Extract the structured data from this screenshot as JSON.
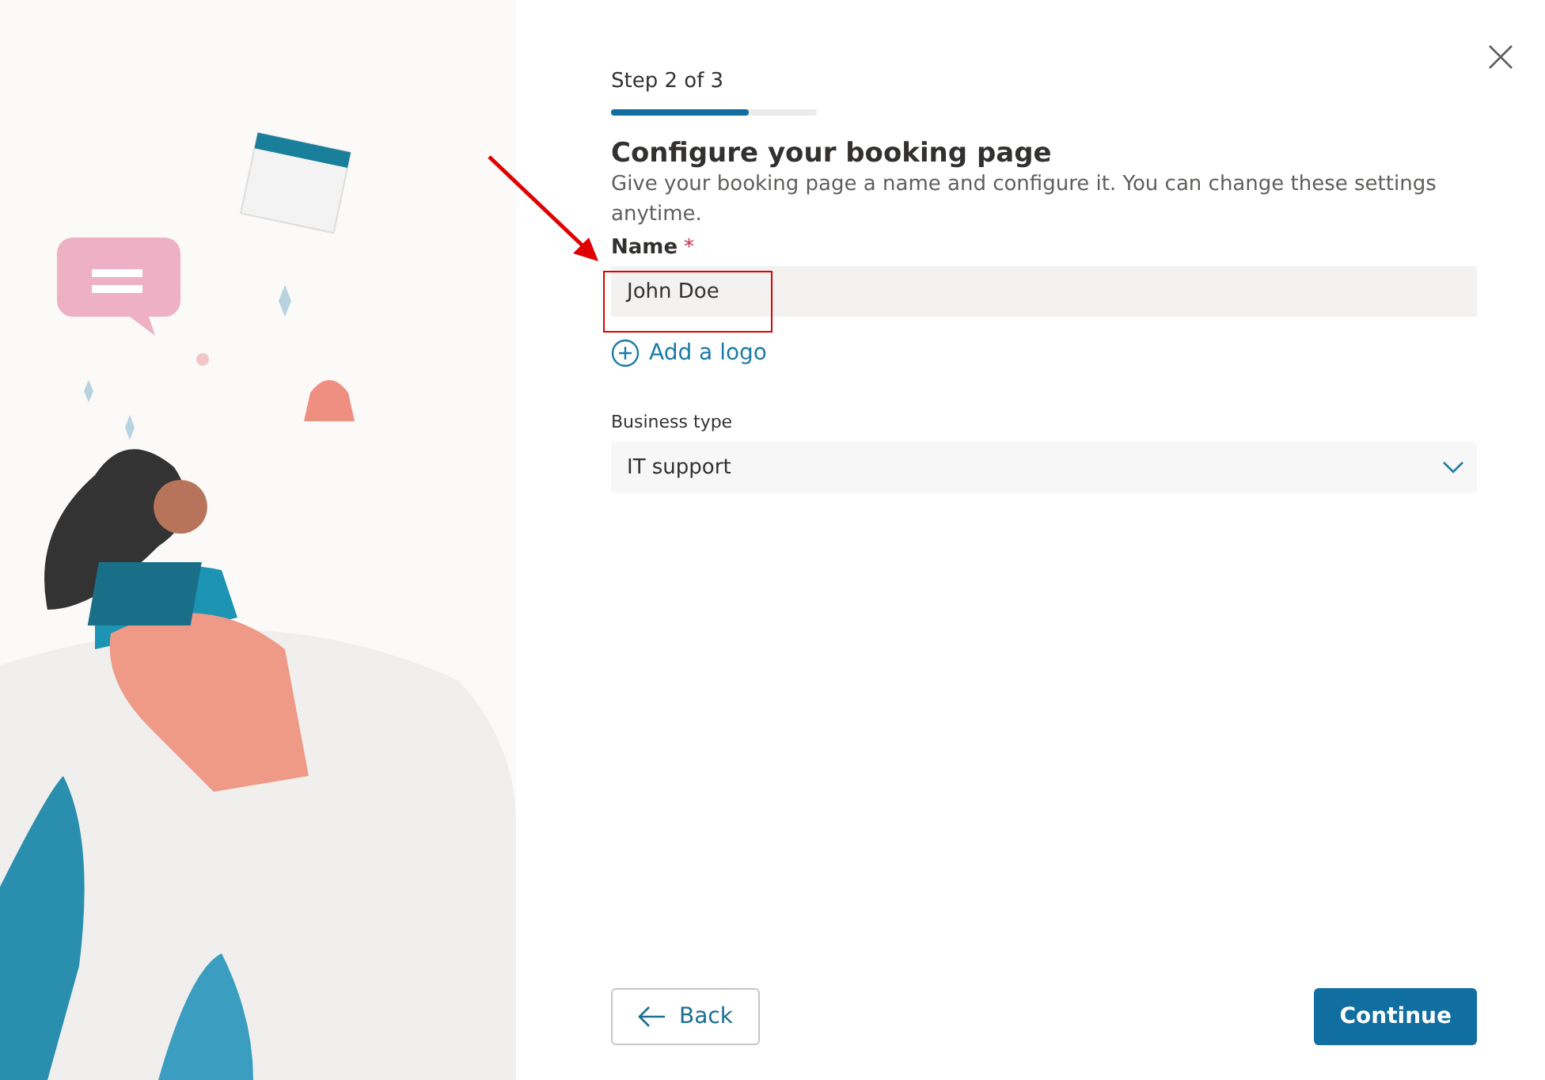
{
  "step": {
    "label": "Step 2 of 3",
    "level": 0.67
  },
  "heading": "Configure your booking page",
  "description": "Give your booking page a name and configure it. You can change these settings anytime.",
  "name_field": {
    "label": "Name",
    "required_mark": "*",
    "value": "John Doe"
  },
  "add_logo": {
    "label": "Add a logo"
  },
  "business_type": {
    "label": "Business type",
    "value": "IT support"
  },
  "buttons": [
    {
      "kind": "secondary",
      "label": "Back"
    },
    {
      "kind": "primary",
      "label": "Continue"
    }
  ]
}
